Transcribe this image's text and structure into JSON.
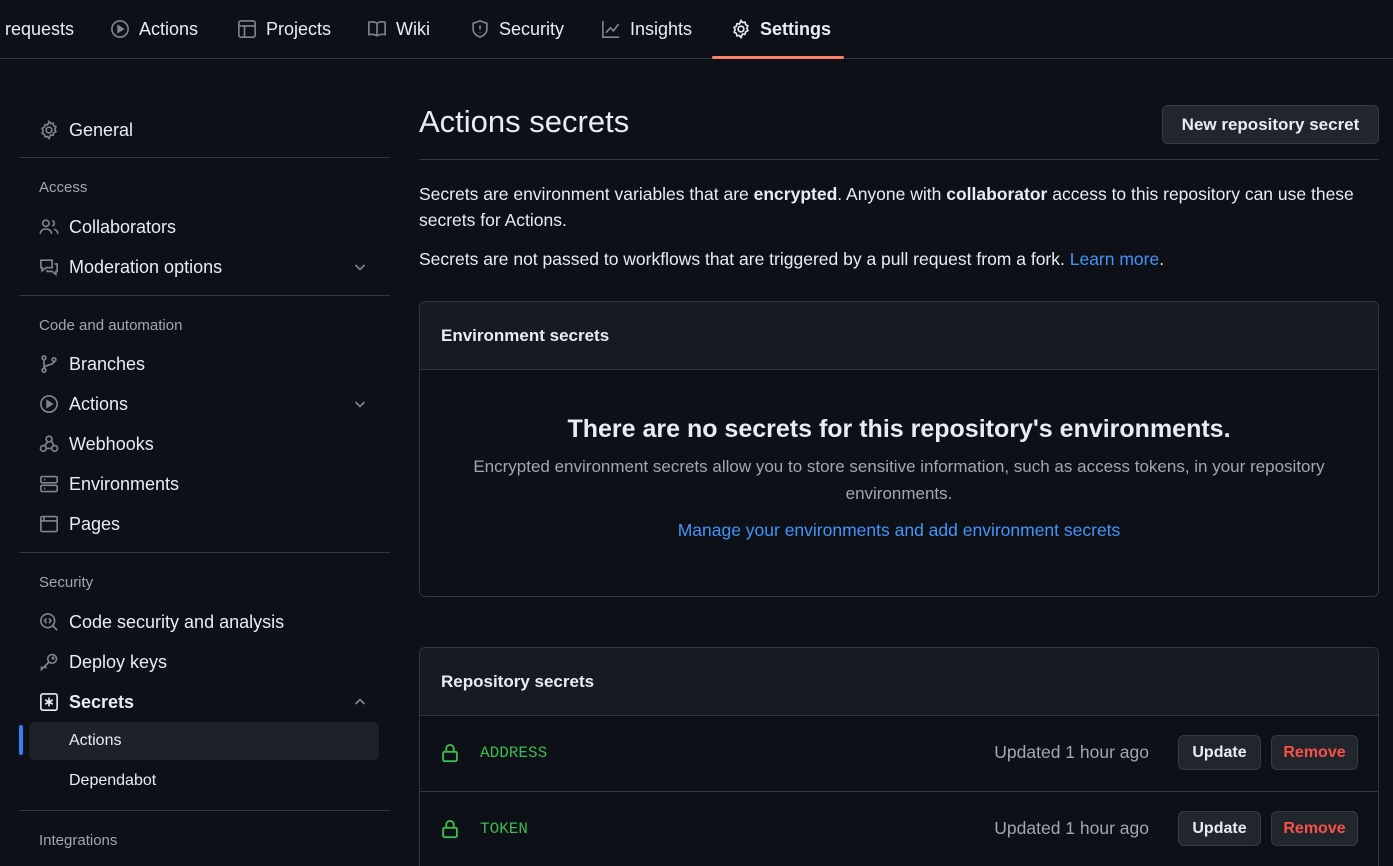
{
  "topnav": {
    "tabs": [
      {
        "label": "requests",
        "icon": null
      },
      {
        "label": "Actions",
        "icon": "play-circle-icon"
      },
      {
        "label": "Projects",
        "icon": "table-icon"
      },
      {
        "label": "Wiki",
        "icon": "book-icon"
      },
      {
        "label": "Security",
        "icon": "shield-icon"
      },
      {
        "label": "Insights",
        "icon": "graph-icon"
      },
      {
        "label": "Settings",
        "icon": "gear-icon",
        "selected": true
      }
    ],
    "accent_color": "#f78166"
  },
  "sidebar": {
    "general": "General",
    "access_heading": "Access",
    "collaborators": "Collaborators",
    "moderation": "Moderation options",
    "code_heading": "Code and automation",
    "branches": "Branches",
    "actions": "Actions",
    "webhooks": "Webhooks",
    "environments": "Environments",
    "pages": "Pages",
    "security_heading": "Security",
    "code_security": "Code security and analysis",
    "deploy_keys": "Deploy keys",
    "secrets": "Secrets",
    "secrets_actions": "Actions",
    "secrets_dependabot": "Dependabot",
    "integrations_heading": "Integrations"
  },
  "main": {
    "title": "Actions secrets",
    "new_secret_button": "New repository secret",
    "desc1_a": "Secrets are environment variables that are ",
    "desc1_b": "encrypted",
    "desc1_c": ". Anyone with ",
    "desc1_d": "collaborator",
    "desc1_e": " access to this repository can use these secrets for Actions.",
    "desc2_a": "Secrets are not passed to workflows that are triggered by a pull request from a fork. ",
    "desc2_link": "Learn more",
    "desc2_end": ".",
    "env_secrets": {
      "header": "Environment secrets",
      "blank_title": "There are no secrets for this repository's environments.",
      "blank_desc": "Encrypted environment secrets allow you to store sensitive information, such as access tokens, in your repository environments.",
      "blank_link": "Manage your environments and add environment secrets"
    },
    "repo_secrets": {
      "header": "Repository secrets",
      "rows": [
        {
          "name": "ADDRESS",
          "updated": "Updated 1 hour ago",
          "update_label": "Update",
          "remove_label": "Remove"
        },
        {
          "name": "TOKEN",
          "updated": "Updated 1 hour ago",
          "update_label": "Update",
          "remove_label": "Remove"
        }
      ]
    }
  },
  "colors": {
    "background": "#0d1117",
    "link": "#4493f8",
    "secret_green": "#3fb950",
    "danger": "#f85149"
  }
}
